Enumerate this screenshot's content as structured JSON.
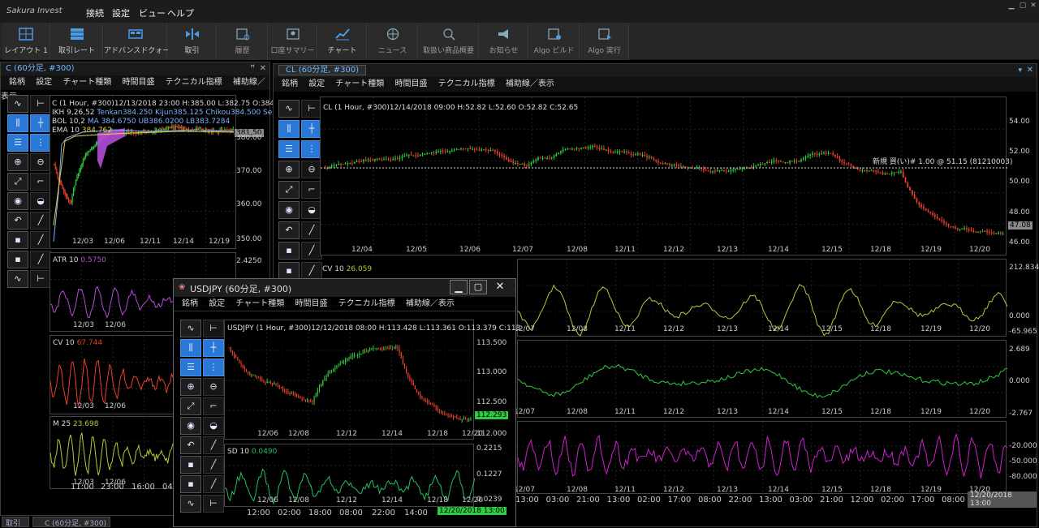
{
  "app": {
    "logo": "Sakura Invest",
    "menu": [
      "接続",
      "設定",
      "ビュー",
      "ヘルプ"
    ]
  },
  "toolbar": [
    {
      "label": "レイアウト 1",
      "icon": "layout-icon"
    },
    {
      "label": "取引レート",
      "icon": "rate-icon"
    },
    {
      "label": "アドバンスドクォート",
      "icon": "quote-icon"
    },
    {
      "label": "取引",
      "icon": "trade-icon"
    },
    {
      "label": "履歴",
      "icon": "history-icon"
    },
    {
      "label": "口座サマリー",
      "icon": "account-icon"
    },
    {
      "label": "チャート",
      "icon": "chart-icon"
    },
    {
      "label": "ニュース",
      "icon": "news-icon"
    },
    {
      "label": "取扱い商品概要",
      "icon": "product-icon"
    },
    {
      "label": "お知らせ",
      "icon": "notice-icon"
    },
    {
      "label": "Algo ビルド",
      "icon": "algo-build-icon"
    },
    {
      "label": "Algo 実行",
      "icon": "algo-run-icon"
    }
  ],
  "chart_menu": [
    "銘柄",
    "設定",
    "チャート種類",
    "時間目盛",
    "テクニカル指標",
    "補助線／表示"
  ],
  "left_panel": {
    "title": "C (60分足, #300)",
    "info_line1": "C (1 Hour, #300)12/13/2018 23:00 H:385.00 L:382.75 O:384",
    "info_ikh": "IKH 9,26,52",
    "info_ikh_vals": "Tenkan384.250 Kijun385.125 Chikou384.500 Sen",
    "info_bol": "BOL 10,2",
    "info_bol_vals": "MA 384.6750 UB386.0200 LB383.7284",
    "info_ema": "EMA 10",
    "info_ema_val": "384.762",
    "price_tag": "381.50",
    "y_labels": [
      "380.00",
      "370.00",
      "360.00",
      "350.00"
    ],
    "x_labels": [
      "12/03",
      "12/06",
      "12/11",
      "12/14",
      "12/19"
    ],
    "atr_label": "ATR 10",
    "atr_val": "0.5750",
    "atr_y": "2.4250",
    "atr_x": [
      "12/03",
      "12/06"
    ],
    "cv_label": "CV 10",
    "cv_val": "67.744",
    "cv_x": [
      "12/03",
      "12/06"
    ],
    "m_label": "M 25",
    "m_val": "23.698",
    "m_x": [
      "12/03",
      "12/06"
    ],
    "time_x": [
      "11:00",
      "23:00",
      "16:00",
      "04:"
    ]
  },
  "main_panel": {
    "title": "CL (60分足, #300)",
    "info_line": "CL (1 Hour, #300)12/14/2018 09:00 H:52.82 L:52.60 O:52.82 C:52.65",
    "order_text": "新規 買(い)# 1.00 @ 51.15 (81210003)",
    "price_tag": "47.08",
    "y_labels": [
      "54.00",
      "52.00",
      "50.00",
      "48.00",
      "46.00"
    ],
    "x_labels": [
      "12/04",
      "12/05",
      "12/06",
      "12/07",
      "12/08",
      "12/11",
      "12/12",
      "12/13",
      "12/14",
      "12/15",
      "12/18",
      "12/19",
      "12/20"
    ],
    "cv_label": "CV 10",
    "cv_val": "26.059",
    "cv_y": [
      "212.834",
      "0.000",
      "-65.965"
    ],
    "osc_y": [
      "2.689",
      "0.000",
      "-2.767"
    ],
    "rsi_y": [
      "-20.000",
      "-50.000",
      "-80.000"
    ],
    "sub_x": [
      "12/07",
      "12/08",
      "12/11",
      "12/12",
      "12/13",
      "12/14",
      "12/15",
      "12/18",
      "12/19",
      "12/20"
    ],
    "time_x": [
      "13:00",
      "03:00",
      "21:00",
      "13:00",
      "02:00",
      "17:00",
      "08:00",
      "22:00",
      "13:00",
      "03:00",
      "21:00",
      "12:00",
      "02:00",
      "17:00",
      "08:00",
      "12:00"
    ],
    "time_tag": "12/20/2018 13:00"
  },
  "popup": {
    "title": "USDJPY (60分足, #300)",
    "info_line": "USDJPY (1 Hour, #300)12/12/2018 08:00 H:113.428 L:113.361 O:113.379 C:113",
    "price_tag": "112.293",
    "y_labels": [
      "113.500",
      "113.000",
      "112.500",
      "112.000"
    ],
    "x_labels": [
      "12/06",
      "12/08",
      "12/12",
      "12/14",
      "12/18",
      "12/20"
    ],
    "sd_label": "SD 10",
    "sd_val": "0.0490",
    "sd_y": [
      "0.2215",
      "0.1227",
      "0.0239"
    ],
    "sd_x": [
      "12/06",
      "12/08",
      "12/12",
      "12/14",
      "12/18",
      "12/20"
    ],
    "time_x": [
      "12:00",
      "02:00",
      "18:00",
      "08:00",
      "22:00",
      "14:00"
    ],
    "time_tag": "12/20/2018 13:00"
  },
  "bottom_tabs": [
    "取引",
    "C (60分足, #300)"
  ],
  "colors": {
    "up": "#2ecc40",
    "down": "#e8402a",
    "accent": "#2a78d6",
    "purple": "#b44cd8",
    "magenta": "#d020d0"
  }
}
